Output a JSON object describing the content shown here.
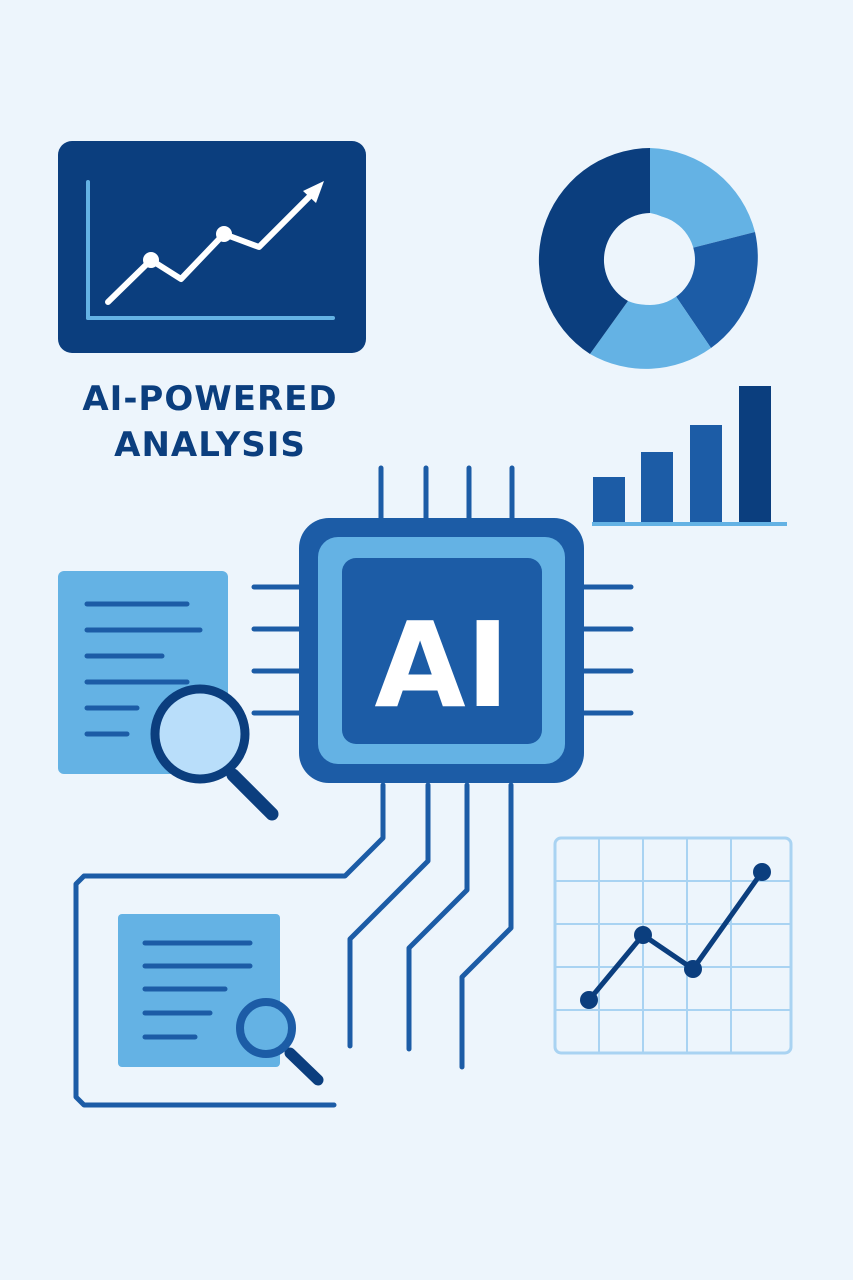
{
  "title": {
    "line1": "AI-POWERED",
    "line2": "ANALYSIS"
  },
  "chip": {
    "label": "AI"
  },
  "colors": {
    "background": "#edf5fc",
    "navy": "#0b3e7e",
    "mid_blue": "#1c5ca6",
    "light_blue": "#64b2e4",
    "pale_blue": "#b9defa",
    "grid_line": "#a9d3f2",
    "white": "#ffffff"
  },
  "icons": {
    "trend_panel": "line-chart-icon",
    "donut": "donut-chart-icon",
    "bars": "bar-chart-icon",
    "chip": "ai-chip-icon",
    "document_large": "document-search-icon",
    "document_small": "document-search-icon",
    "grid_chart": "grid-line-chart-icon"
  }
}
